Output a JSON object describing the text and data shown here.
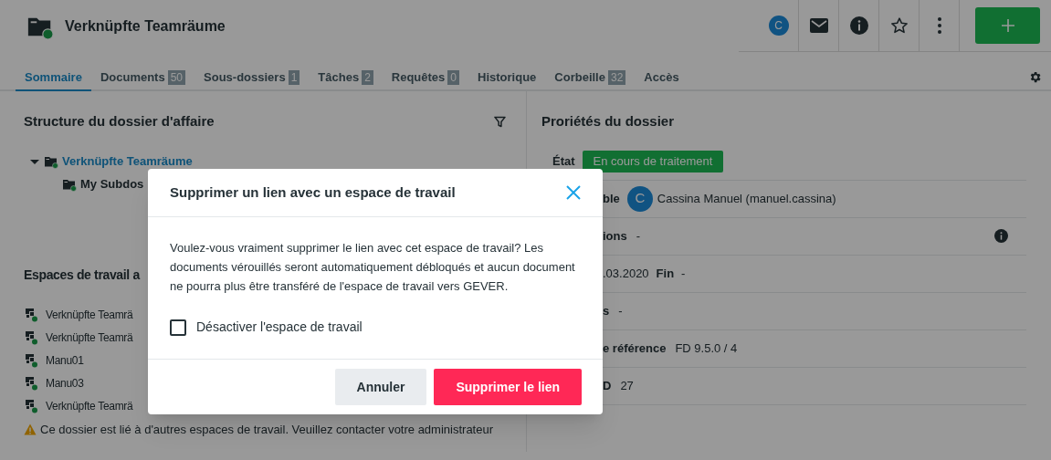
{
  "header": {
    "title": "Verknüpfte Teamräume",
    "avatar": "C"
  },
  "tabs": [
    {
      "label": "Sommaire",
      "selected": true
    },
    {
      "label": "Documents",
      "count": "50",
      "selected": false
    },
    {
      "label": "Sous-dossiers",
      "count": "1",
      "selected": false
    },
    {
      "label": "Tâches",
      "count": "2",
      "selected": false
    },
    {
      "label": "Requêtes",
      "count": "0",
      "selected": false
    },
    {
      "label": "Historique",
      "selected": false
    },
    {
      "label": "Corbeille",
      "count": "32",
      "selected": false
    },
    {
      "label": "Accès",
      "selected": false
    }
  ],
  "structure": {
    "title": "Structure du dossier d'affaire",
    "tree": [
      {
        "label": "Verknüpfte Teamräume",
        "expanded": true,
        "selected": true,
        "children": [
          {
            "label": "My Subdos",
            "selected": false
          }
        ]
      }
    ]
  },
  "workspaces": {
    "title": "Espaces de travail a",
    "items": [
      "Verknüpfte Teamrä",
      "Verknüpfte Teamrä",
      "Manu01",
      "Manu03",
      "Verknüpfte Teamrä"
    ],
    "warning": "Ce dossier est lié à d'autres espaces de travail. Veuillez contacter votre administrateur"
  },
  "properties": {
    "title": "Proriétés du dossier",
    "rows": [
      {
        "kind": "badge",
        "label": "État",
        "value": "En cours de traitement"
      },
      {
        "kind": "person",
        "label": "ble",
        "avatar": "C",
        "value": "Cassina Manuel (manuel.cassina)"
      },
      {
        "kind": "text_info",
        "label": "ions",
        "value": "-"
      },
      {
        "kind": "dates",
        "value": ".03.2020",
        "end_label": "Fin",
        "end_value": "-"
      },
      {
        "kind": "text",
        "label": "s",
        "value": "-"
      },
      {
        "kind": "text",
        "label": "e référence",
        "value": "FD 9.5.0 / 4"
      },
      {
        "kind": "text",
        "label": "D",
        "value": "27"
      }
    ]
  },
  "dialog": {
    "title": "Supprimer un lien avec un espace de travail",
    "message": "Voulez-vous vraiment supprimer le lien avec cet espace de travail? Les documents vérouillés seront automatiquement débloqués et aucun document ne pourra plus être transféré de l'espace de travail vers GEVER.",
    "checkbox": {
      "label": "Désactiver l'espace de travail",
      "checked": false
    },
    "buttons": [
      {
        "kind": "secondary",
        "label": "Annuler"
      },
      {
        "kind": "danger",
        "label": "Supprimer le lien"
      }
    ]
  }
}
